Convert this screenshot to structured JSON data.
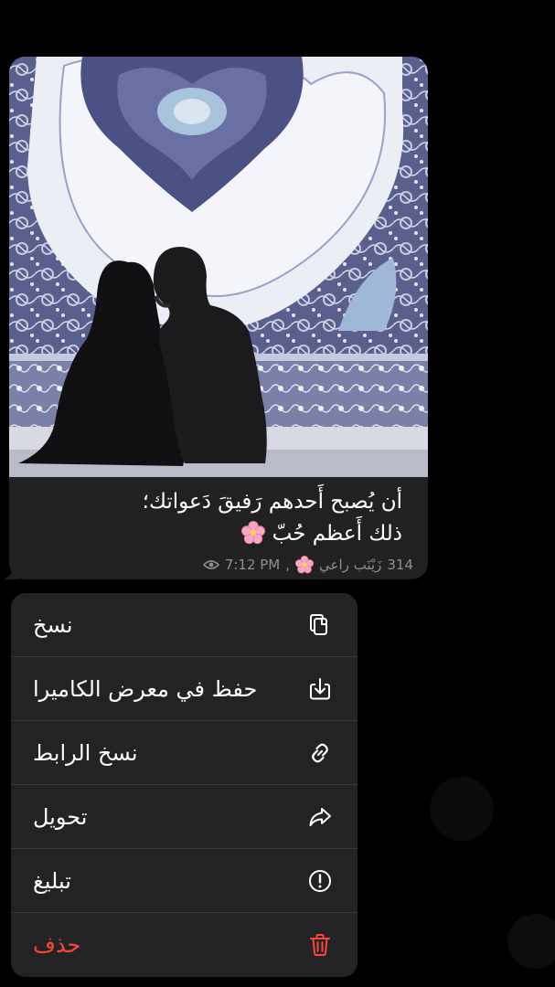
{
  "message": {
    "caption_line1": "أن يُصبح أَحدهم رَفيقَ دَعواتك؛",
    "caption_line2": "ذلك أَعظم حُبّ",
    "views": "314",
    "author": "زَيْنَب راعي",
    "time": "7:12 PM",
    "icons": {
      "views": "eye-icon",
      "flower": "cherry-blossom-emoji"
    }
  },
  "menu": {
    "items": [
      {
        "label": "نسخ",
        "icon": "copy-icon"
      },
      {
        "label": "حفظ في معرض الكاميرا",
        "icon": "save-download-icon"
      },
      {
        "label": "نسخ الرابط",
        "icon": "link-icon"
      },
      {
        "label": "تحويل",
        "icon": "forward-icon"
      },
      {
        "label": "تبليغ",
        "icon": "report-icon"
      },
      {
        "label": "حذف",
        "icon": "trash-icon"
      }
    ]
  },
  "colors": {
    "background": "#000000",
    "bubble": "#212121",
    "menu": "#232325",
    "danger": "#ff453a",
    "meta_text": "#8e8e93"
  }
}
